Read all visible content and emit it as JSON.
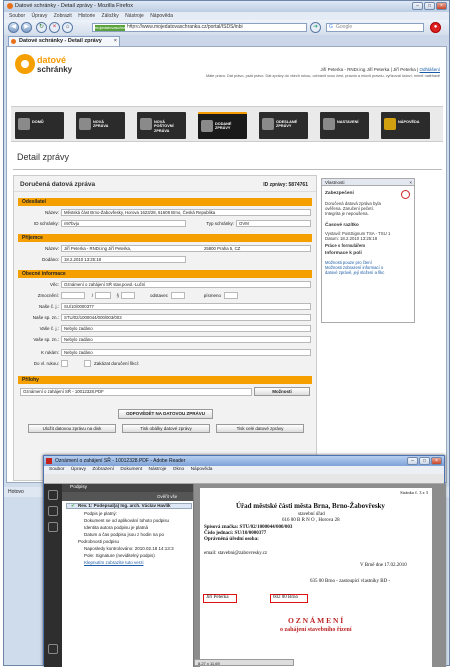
{
  "browser": {
    "title": "Datové schránky - Detail zprávy - Mozilla Firefox",
    "menu": [
      "Soubor",
      "Úpravy",
      "Zobrazit",
      "Historie",
      "Záložky",
      "Nástroje",
      "Nápověda"
    ],
    "url_badge": "mojedatovaschranka.cz",
    "url": "https://www.mojedatovaschranka.cz/portal/ISDS/inbi",
    "search_placeholder": "Google",
    "tab_label": "Datové schránky - Detail zprávy",
    "status": "Hotovo"
  },
  "header": {
    "logo_line1": "datové",
    "logo_line2": "schránky",
    "user_text": "Jiří Peterka - RNDr.ing Jiří Peterka | Jiří Peterka |",
    "logout": "Odhlášení",
    "motto": "Máte právo. Dát právo, psát právo. Dát zprávy do všech rukou, ochránit svou čest, pravdu a mluvit pravdu, vyřizovat úsloví, mírně naléhavě"
  },
  "menu_items": [
    {
      "label": "DOMŮ",
      "active": false
    },
    {
      "label": "NOVÁ\nZPRÁVA",
      "active": false
    },
    {
      "label": "NOVÁ\nPOŠTOVNÍ\nZPRÁVA",
      "active": false
    },
    {
      "label": "DODANÉ\nZPRÁVY",
      "active": true
    },
    {
      "label": "ODESLANÉ\nZPRÁVY",
      "active": false
    },
    {
      "label": "NASTAVENÍ",
      "active": false
    },
    {
      "label": "NÁPOVĚDA",
      "active": false
    }
  ],
  "page_title": "Detail zprávy",
  "message": {
    "heading": "Doručená datová zpráva",
    "id_label": "ID zprávy:",
    "id_value": "5874761",
    "sender_title": "Odesílatel",
    "sender_name_label": "Název:",
    "sender_name": "Městská část Brno-Žabovřesky, Horova 1623/28, 61608 Brno, Česká Republika",
    "sender_box_label": "ID schránky:",
    "sender_box": "n97bvju",
    "sender_type_label": "Typ schránky:",
    "sender_type": "OVM",
    "recipient_title": "Příjemce",
    "recipient_name_label": "Název:",
    "recipient_name": "Jiří Peterka - RNDr.ing Jiří Peterka,",
    "recipient_addr": "25800 Praha 5, CZ",
    "delivered_label": "Dodáno:",
    "delivered": "18.2.2010 13:25:18",
    "general_title": "Obecné informace",
    "subject_label": "Věc:",
    "subject": "Oznámení o zahájení SŘ stav.povol.-Luční",
    "auth_label": "Zmocnění:",
    "slash": "/",
    "para_label": "§",
    "odst_label": "odstavec",
    "pismeno_label": "písmeno",
    "our_ref_label": "Naše č. j.:",
    "our_ref": "SU/10/0000377",
    "our_file_label": "Naše sp. zn.:",
    "our_file": "STU/02/1000044/000/003/003",
    "your_ref_label": "Vaše č. j.:",
    "your_ref": "Nebylo zadáno",
    "your_file_label": "Vaše sp. zn.:",
    "your_file": "Nebylo zadáno",
    "attn_label": "K rukám:",
    "attn": "Nebylo zadáno",
    "own_hands_label": "Do vl. rukou:",
    "fiction_label": "Zakázat doručení fikcí:",
    "attachments_title": "Přílohy",
    "attachment": "Oznámení o zahájení SŘ - 10012328.PDF",
    "options_btn": "Možnosti",
    "reply_btn": "ODPOVĚDĚT NA DATOVOU ZPRÁVU",
    "btn_save": "Uložit datovou zprávu na disk",
    "btn_print": "Tisk obálky datové zprávy",
    "btn_print_all": "Tisk celé datové zprávy"
  },
  "properties": {
    "title": "Vlastnosti",
    "close": "×",
    "security_title": "Zabezpečení",
    "security_text": [
      "Doručená datová zpráva byla",
      "ověřena. Zaručení pečetí.",
      "Integrita je nepoušena."
    ],
    "timestamp_title": "Časové razítko",
    "timestamp_text": [
      "Vystavil: PostSignum TSA - TSU 1",
      "Datum:  18.2.2010 13:25:18"
    ],
    "tools_title": "Práce s formulářem",
    "info_title": "Informace k poli",
    "info_links": [
      "Možnosti pouze pro čtení",
      "Možnosti zobrazení informací o",
      "datové zprávě, její složení a fikc"
    ]
  },
  "reader": {
    "title": "Oznámení o zahájení SŘ - 10012328.PDF - Adobe Reader",
    "menu": [
      "Soubor",
      "Úpravy",
      "Zobrazení",
      "Dokument",
      "Nástroje",
      "Okno",
      "Nápověda"
    ],
    "panel_title": "Podpisy",
    "panel_tool": "Ověřit vše",
    "signature": "Rev. 1: Podepsal(a) Ing. arch. Václav Havlík",
    "sig_items": [
      "Podpis je platný:",
      "Dokument se od aplikování tohoto podpisu",
      "Identita autora podpisu je platná",
      "Datum a čas podpisu jsou z hodin na po"
    ],
    "sig_details": "Podrobnosti podpisu",
    "sig_verified": "Naposledy kontrolováno: 2010.02.18 14:13:3",
    "sig_field": "Pole: Signature (neviditelný podpis)",
    "sig_link": "Klepnutím zobrazíte tuto verzi",
    "page_info": "Stránka č. 3 z 3",
    "doc_title": "Úřad městské části města Brna, Brno-Žabovřesky",
    "doc_sub": "stavební úřad",
    "doc_addr": "616 00   B R N O ,   Horova 28",
    "doc_f1": "Spisová značka:  STU/02/1000044/000/003",
    "doc_f2": "Číslo jednací:  SU/10/0000377",
    "doc_f3": "Oprávněná úřední osoba:",
    "doc_f4": "email: stavebni@zabovresky.cz",
    "doc_date": "V Brně dne 17.02.2010",
    "doc_line": "635 00 Brno - zastoupící vlastníky BD -",
    "doc_name": "Jiří Peterka",
    "doc_zip": "602 00 Brno",
    "doc_h1": "O Z N Á M E N Í",
    "doc_h2": "o zahájení stavebního řízení",
    "size": "8,27 x 11,69"
  }
}
